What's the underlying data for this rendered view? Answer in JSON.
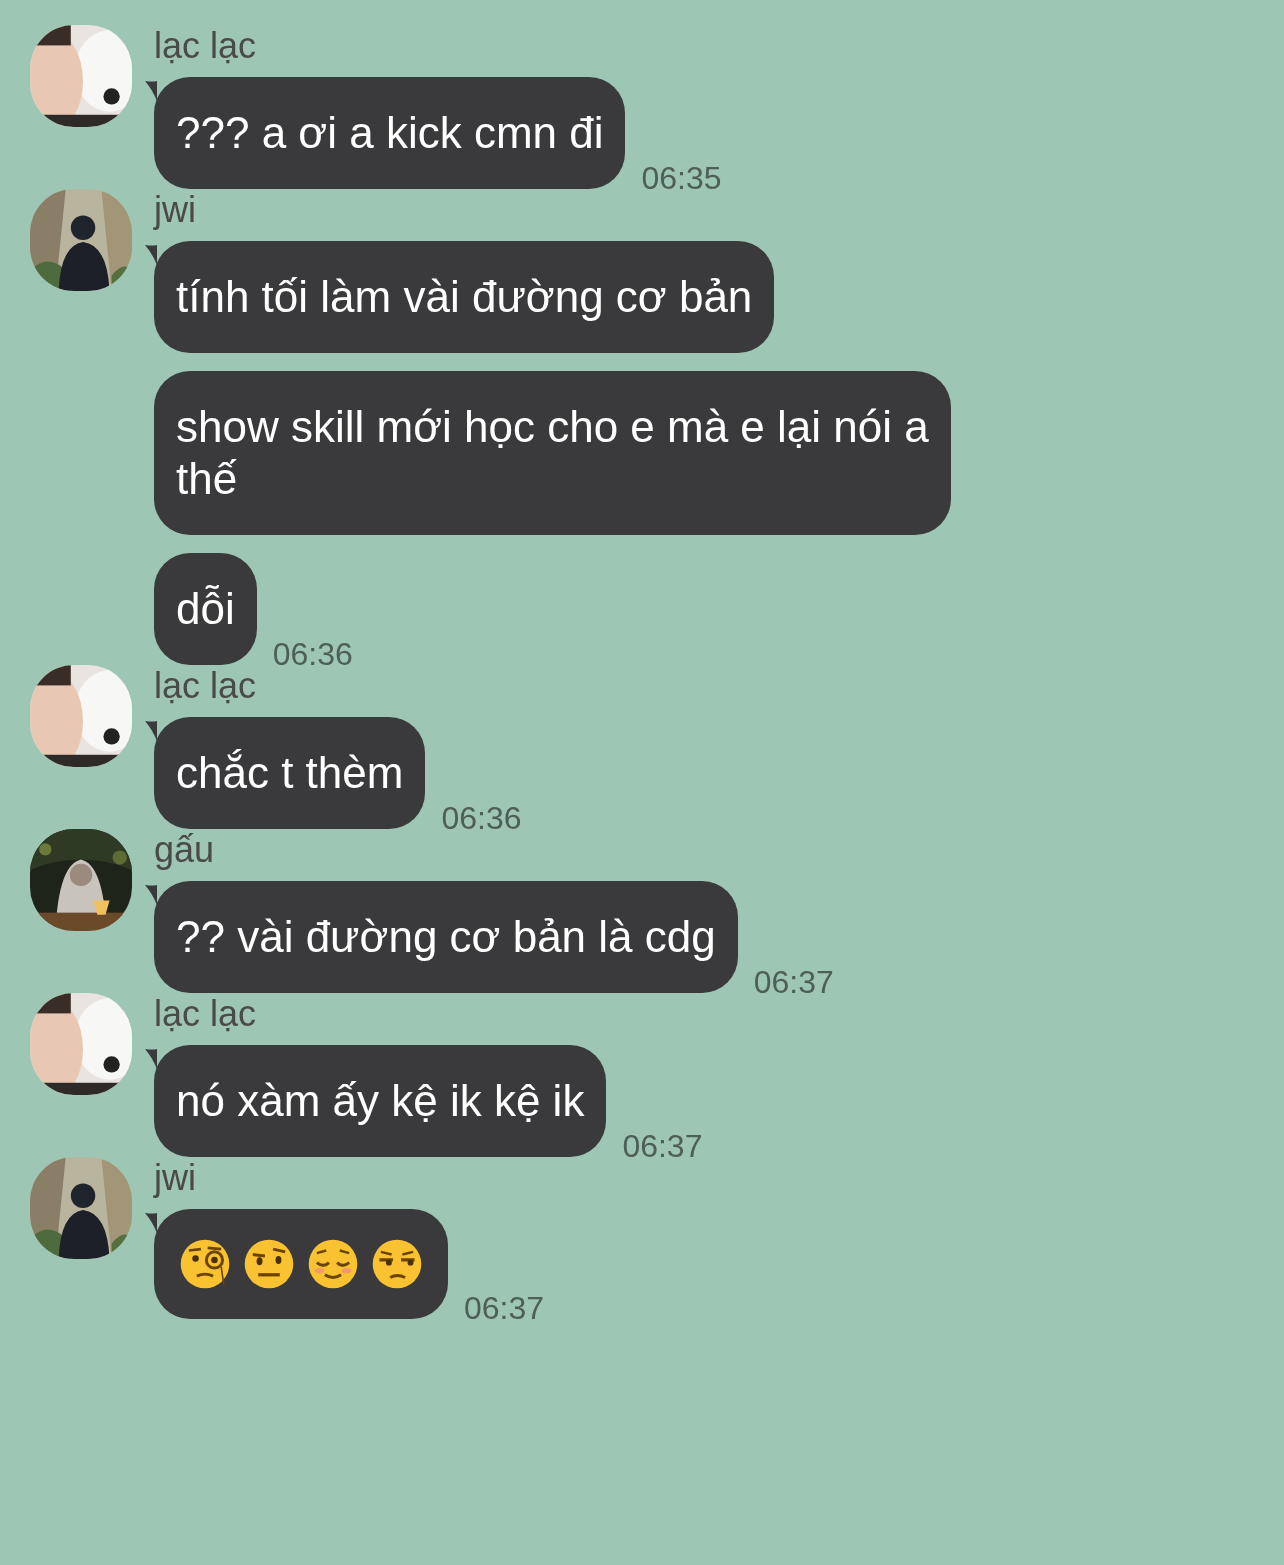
{
  "groups": [
    {
      "sender": "lạc lạc",
      "avatar": {
        "kind": "picture"
      },
      "messages": [
        {
          "kind": "text",
          "text": "??? a ơi a kick cmn đi"
        }
      ],
      "time": "06:35"
    },
    {
      "sender": "jwi",
      "avatar": {
        "kind": "picture"
      },
      "messages": [
        {
          "kind": "text",
          "text": "tính tối làm vài đường cơ bản"
        },
        {
          "kind": "text",
          "text": "show skill mới học cho e mà e lại nói a thế"
        },
        {
          "kind": "text",
          "text": "dỗi"
        }
      ],
      "time": "06:36"
    },
    {
      "sender": "lạc lạc",
      "avatar": {
        "kind": "picture"
      },
      "messages": [
        {
          "kind": "text",
          "text": "chắc t thèm"
        }
      ],
      "time": "06:36"
    },
    {
      "sender": "gấu",
      "avatar": {
        "kind": "picture"
      },
      "messages": [
        {
          "kind": "text",
          "text": "?? vài đường cơ bản là cdg"
        }
      ],
      "time": "06:37"
    },
    {
      "sender": "lạc lạc",
      "avatar": {
        "kind": "picture"
      },
      "messages": [
        {
          "kind": "text",
          "text": "nó xàm ấy kệ ik kệ ik"
        }
      ],
      "time": "06:37"
    },
    {
      "sender": "jwi",
      "avatar": {
        "kind": "picture"
      },
      "messages": [
        {
          "kind": "emoji",
          "icons": [
            {
              "kind": "monocle"
            },
            {
              "kind": "raised-eyebrow"
            },
            {
              "kind": "relieved"
            },
            {
              "kind": "unamused"
            }
          ]
        }
      ],
      "time": "06:37"
    }
  ]
}
